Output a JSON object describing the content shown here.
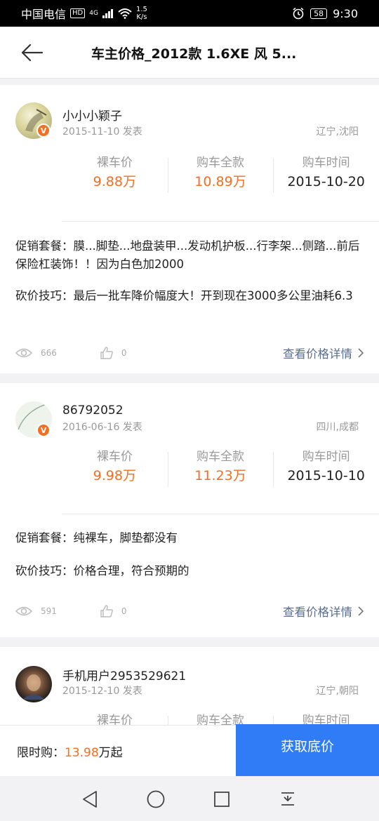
{
  "status_bar": {
    "carrier": "中国电信",
    "hd": "HD",
    "net": "4G",
    "speed_value": "1.5",
    "speed_unit": "K/s",
    "battery": "58",
    "time": "9:30"
  },
  "header": {
    "title": "车主价格_2012款 1.6XE 风 5..."
  },
  "posts": [
    {
      "username": "小小小颖子",
      "date": "2015-11-10 发表",
      "location": "辽宁,沈阳",
      "stats": [
        {
          "label": "裸车价",
          "value": "9.88万"
        },
        {
          "label": "购车全款",
          "value": "10.89万"
        },
        {
          "label": "购车时间",
          "value": "2015-10-20"
        }
      ],
      "promo": "促销套餐：膜...脚垫...地盘装甲...发动机护板...行李架...侧踏...前后保险杠装饰！！因为白色加2000",
      "tip": "砍价技巧：最后一批车降价幅度大！开到现在3000多公里油耗6.3",
      "views": "666",
      "likes": "0",
      "detail_link": "查看价格详情"
    },
    {
      "username": "86792052",
      "date": "2016-06-16 发表",
      "location": "四川,成都",
      "stats": [
        {
          "label": "裸车价",
          "value": "9.98万"
        },
        {
          "label": "购车全款",
          "value": "11.23万"
        },
        {
          "label": "购车时间",
          "value": "2015-10-10"
        }
      ],
      "promo": "促销套餐：纯裸车，脚垫都没有",
      "tip": "砍价技巧：价格合理，符合预期的",
      "views": "591",
      "likes": "0",
      "detail_link": "查看价格详情"
    },
    {
      "username": "手机用户2953529621",
      "date": "2015-12-10 发表",
      "location": "辽宁,朝阳",
      "stats": [
        {
          "label": "裸车价"
        },
        {
          "label": "购车全款"
        },
        {
          "label": "购车时间"
        }
      ]
    }
  ],
  "bottom_bar": {
    "limit_prefix": "限时购：",
    "limit_price": "13.98",
    "limit_suffix": "万起",
    "cta": "获取底价"
  },
  "colors": {
    "accent": "#f36f21",
    "cta": "#2f7cf6",
    "link": "#5b6e8f"
  }
}
